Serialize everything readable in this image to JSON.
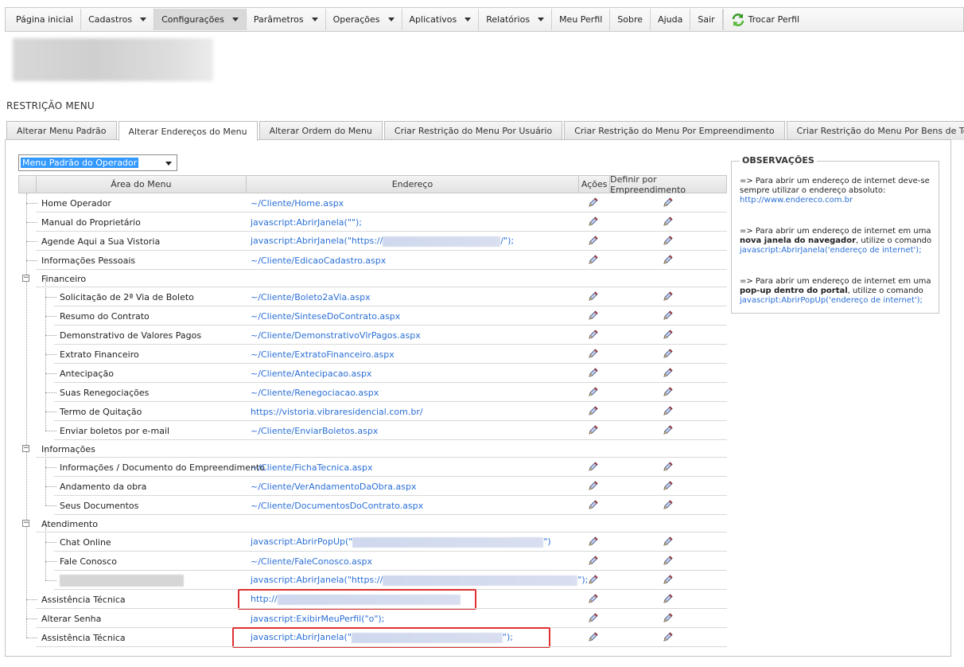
{
  "topmenu": {
    "items": [
      {
        "label": "Página inicial",
        "has_caret": false
      },
      {
        "label": "Cadastros",
        "has_caret": true
      },
      {
        "label": "Configurações",
        "has_caret": true,
        "active": true
      },
      {
        "label": "Parâmetros",
        "has_caret": true
      },
      {
        "label": "Operações",
        "has_caret": true
      },
      {
        "label": "Aplicativos",
        "has_caret": true
      },
      {
        "label": "Relatórios",
        "has_caret": true
      },
      {
        "label": "Meu Perfil",
        "has_caret": false
      },
      {
        "label": "Sobre",
        "has_caret": false
      },
      {
        "label": "Ajuda",
        "has_caret": false
      },
      {
        "label": "Sair",
        "has_caret": false
      }
    ],
    "switch_profile": "Trocar Perfil"
  },
  "page_title": "RESTRIÇÃO MENU",
  "tabs": [
    {
      "label": "Alterar Menu Padrão"
    },
    {
      "label": "Alterar Endereços do Menu",
      "active": true
    },
    {
      "label": "Alterar Ordem do Menu"
    },
    {
      "label": "Criar Restrição do Menu Por Usuário"
    },
    {
      "label": "Criar Restrição do Menu Por Empreendimento"
    },
    {
      "label": "Criar Restrição do Menu Por Bens de Terceiro"
    }
  ],
  "menu_select": {
    "value": "Menu Padrão do Operador"
  },
  "grid": {
    "headers": {
      "area": "Área do Menu",
      "address": "Endereço",
      "actions": "Ações",
      "define": "Definir por Empreendimento"
    },
    "rows": [
      {
        "level": 0,
        "area": "Home Operador",
        "address": "~/Cliente/Home.aspx"
      },
      {
        "level": 0,
        "area": "Manual do Proprietário",
        "address": "javascript:AbrirJanela(\"\");"
      },
      {
        "level": 0,
        "area": "Agende Aqui a Sua Vistoria",
        "address_prefix": "javascript:AbrirJanela(\"https://",
        "address_suffix": "/\");",
        "blurred": true
      },
      {
        "level": 0,
        "area": "Informações Pessoais",
        "address": "~/Cliente/EdicaoCadastro.aspx"
      },
      {
        "level": 0,
        "area": "Financeiro",
        "group": true
      },
      {
        "level": 1,
        "area": "Solicitação de 2ª Via de Boleto",
        "address": "~/Cliente/Boleto2aVia.aspx"
      },
      {
        "level": 1,
        "area": "Resumo do Contrato",
        "address": "~/Cliente/SinteseDoContrato.aspx"
      },
      {
        "level": 1,
        "area": "Demonstrativo de Valores Pagos",
        "address": "~/Cliente/DemonstrativoVlrPagos.aspx"
      },
      {
        "level": 1,
        "area": "Extrato Financeiro",
        "address": "~/Cliente/ExtratoFinanceiro.aspx"
      },
      {
        "level": 1,
        "area": "Antecipação",
        "address": "~/Cliente/Antecipacao.aspx"
      },
      {
        "level": 1,
        "area": "Suas Renegociações",
        "address": "~/Cliente/Renegociacao.aspx"
      },
      {
        "level": 1,
        "area": "Termo de Quitação",
        "address": "https://vistoria.vibraresidencial.com.br/"
      },
      {
        "level": 1,
        "area": "Enviar boletos por e-mail",
        "address": "~/Cliente/EnviarBoletos.aspx"
      },
      {
        "level": 0,
        "area": "Informações",
        "group": true
      },
      {
        "level": 1,
        "area": "Informações / Documento do Empreendimento",
        "address": "~/Cliente/FichaTecnica.aspx"
      },
      {
        "level": 1,
        "area": "Andamento da obra",
        "address": "~/Cliente/VerAndamentoDaObra.aspx"
      },
      {
        "level": 1,
        "area": "Seus Documentos",
        "address": "~/Cliente/DocumentosDoContrato.aspx"
      },
      {
        "level": 0,
        "area": "Atendimento",
        "group": true
      },
      {
        "level": 1,
        "area": "Chat Online",
        "address_prefix": "javascript:AbrirPopUp(\"",
        "address_suffix": "\")",
        "blurred": true
      },
      {
        "level": 1,
        "area": "Fale Conosco",
        "address": "~/Cliente/FaleConosco.aspx"
      },
      {
        "level": 1,
        "area": "",
        "address_prefix": "javascript:AbrirJanela(\"https://",
        "address_suffix": "\");",
        "blurred": true,
        "area_blurred": true
      },
      {
        "level": 0,
        "area": "Assistência Técnica",
        "address_prefix": "http://",
        "address_suffix": "",
        "blurred": true,
        "highlight": true
      },
      {
        "level": 0,
        "area": "Alterar Senha",
        "address": "javascript:ExibirMeuPerfil(\"o\");"
      },
      {
        "level": 0,
        "area": "Assistência Técnica",
        "address_prefix": "javascript:AbrirJanela(\"",
        "address_suffix": "\");",
        "blurred": true,
        "highlight": true
      }
    ]
  },
  "observations": {
    "title": "OBSERVAÇÕES",
    "note1_text": "=> Para abrir um endereço de internet deve-se sempre utilizar o endereço absoluto:",
    "note1_example": "http://www.endereco.com.br",
    "note2_text_a": "=> Para abrir um endereço de internet em uma ",
    "note2_bold": "nova janela do navegador",
    "note2_text_b": ", utilize o comando",
    "note2_code": "javascript:AbrirJanela('endereço de internet');",
    "note3_text_a": "=> Para abrir um endereço de internet em uma ",
    "note3_bold": "pop-up dentro do portal",
    "note3_text_b": ", utilize o comando",
    "note3_code": "javascript:AbrirPopUp('endereço de internet');"
  },
  "colors": {
    "link": "#2a6fd6",
    "highlight": "#e03030",
    "select_bg": "#3399ff"
  },
  "icons": {
    "edit": "pencil-icon",
    "switch_profile": "refresh-icon",
    "tree_toggle": "collapse-minus-icon"
  }
}
